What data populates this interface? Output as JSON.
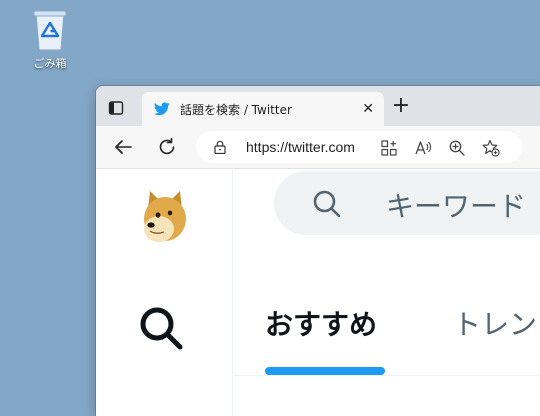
{
  "desktop": {
    "recycle_bin_label": "ごみ箱"
  },
  "browser": {
    "tab": {
      "title": "話題を検索 / Twitter",
      "close_glyph": "✕",
      "favicon": "twitter-bird-icon"
    },
    "new_tab_glyph": "+",
    "address": {
      "url": "https://twitter.com"
    }
  },
  "twitter": {
    "search_placeholder": "キーワード",
    "tabs": [
      {
        "label": "おすすめ",
        "active": true
      },
      {
        "label": "トレンド",
        "active": false
      }
    ],
    "accent_color": "#1d9bf0"
  }
}
